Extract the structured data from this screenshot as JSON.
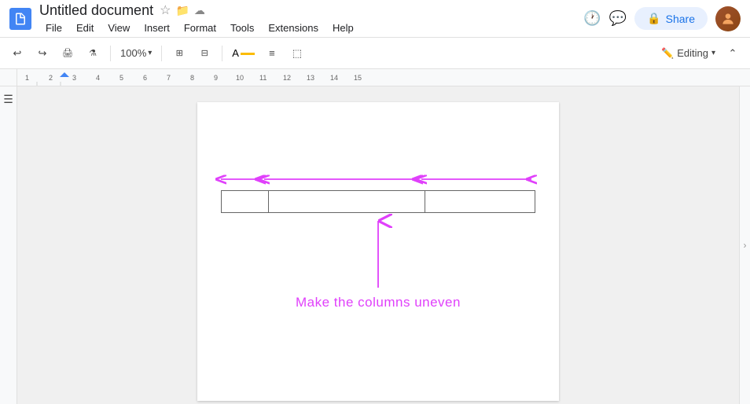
{
  "titleBar": {
    "docTitle": "Untitled document",
    "starIcon": "★",
    "folderIcon": "📁",
    "cloudIcon": "☁",
    "menuItems": [
      "File",
      "Edit",
      "View",
      "Insert",
      "Format",
      "Tools",
      "Extensions",
      "Help"
    ],
    "historyIcon": "🕐",
    "commentIcon": "💬",
    "shareLabel": "Share",
    "lockIcon": "🔒"
  },
  "toolbar": {
    "undoLabel": "↩",
    "redoLabel": "↪",
    "printLabel": "🖨",
    "formatLabel": "⌥",
    "zoom": "100%",
    "moreIcon": "⊞",
    "editingLabel": "Editing"
  },
  "annotations": {
    "arrowText": "Make the columns uneven"
  },
  "colors": {
    "magenta": "#e040fb",
    "tableStroke": "#666666",
    "docBg": "#ffffff",
    "pageBg": "#f0f0f0"
  }
}
